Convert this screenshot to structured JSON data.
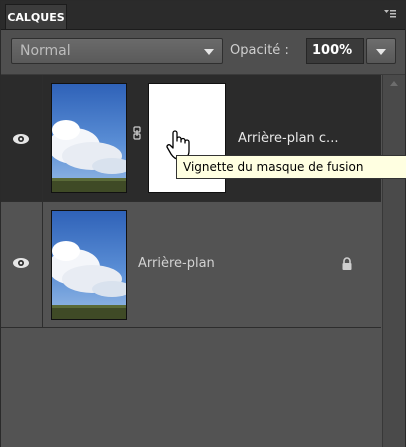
{
  "panel": {
    "tab_label": "CALQUES",
    "menu_icon": "panel-menu-icon"
  },
  "toolbar": {
    "blend_mode": "Normal",
    "opacity_label": "Opacité :",
    "opacity_value": "100%"
  },
  "layers": [
    {
      "name": "Arrière-plan c...",
      "visible_icon": "eye-icon",
      "has_mask": true,
      "selected": true
    },
    {
      "name": "Arrière-plan",
      "visible_icon": "eye-icon",
      "locked": true,
      "selected": false
    }
  ],
  "tooltip": {
    "text": "Vignette du masque de fusion"
  },
  "colors": {
    "selected_row": "#2b2b2b",
    "panel_bg": "#535353",
    "tooltip_bg": "#ffffe1"
  }
}
